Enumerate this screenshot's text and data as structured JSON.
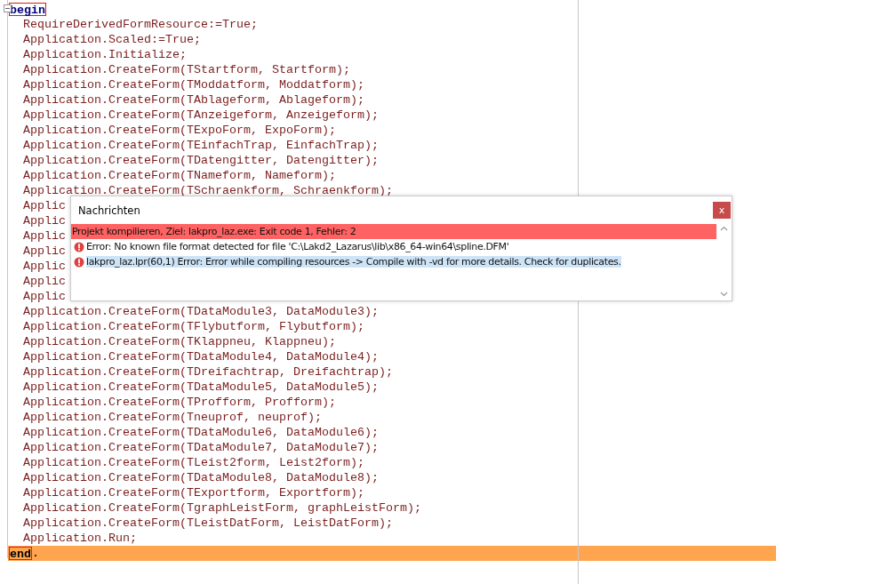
{
  "editor": {
    "lines": [
      {
        "kind": "keyword",
        "keyword": "begin",
        "matched": true,
        "current": false
      },
      {
        "kind": "code",
        "text": "RequireDerivedFormResource:=True;"
      },
      {
        "kind": "code",
        "text": "Application.Scaled:=True;"
      },
      {
        "kind": "code",
        "text": "Application.Initialize;"
      },
      {
        "kind": "code",
        "text": "Application.CreateForm(TStartform, Startform);"
      },
      {
        "kind": "code",
        "text": "Application.CreateForm(TModdatform, Moddatform);"
      },
      {
        "kind": "code",
        "text": "Application.CreateForm(TAblageform, Ablageform);"
      },
      {
        "kind": "code",
        "text": "Application.CreateForm(TAnzeigeform, Anzeigeform);"
      },
      {
        "kind": "code",
        "text": "Application.CreateForm(TExpoForm, ExpoForm);"
      },
      {
        "kind": "code",
        "text": "Application.CreateForm(TEinfachTrap, EinfachTrap);"
      },
      {
        "kind": "code",
        "text": "Application.CreateForm(TDatengitter, Datengitter);"
      },
      {
        "kind": "code",
        "text": "Application.CreateForm(TNameform, Nameform);"
      },
      {
        "kind": "code",
        "text": "Application.CreateForm(TSchraenkform, Schraenkform);"
      },
      {
        "kind": "code",
        "text": "Applic"
      },
      {
        "kind": "code",
        "text": "Applic"
      },
      {
        "kind": "code",
        "text": "Applic"
      },
      {
        "kind": "code",
        "text": "Applic"
      },
      {
        "kind": "code",
        "text": "Applic"
      },
      {
        "kind": "code",
        "text": "Applic"
      },
      {
        "kind": "code",
        "text": "Applic"
      },
      {
        "kind": "code",
        "text": "Application.CreateForm(TDataModule3, DataModule3);"
      },
      {
        "kind": "code",
        "text": "Application.CreateForm(TFlybutform, Flybutform);"
      },
      {
        "kind": "code",
        "text": "Application.CreateForm(TKlappneu, Klappneu);"
      },
      {
        "kind": "code",
        "text": "Application.CreateForm(TDataModule4, DataModule4);"
      },
      {
        "kind": "code",
        "text": "Application.CreateForm(TDreifachtrap, Dreifachtrap);"
      },
      {
        "kind": "code",
        "text": "Application.CreateForm(TDataModule5, DataModule5);"
      },
      {
        "kind": "code",
        "text": "Application.CreateForm(TProfform, Profform);"
      },
      {
        "kind": "code",
        "text": "Application.CreateForm(Tneuprof, neuprof);"
      },
      {
        "kind": "code",
        "text": "Application.CreateForm(TDataModule6, DataModule6);"
      },
      {
        "kind": "code",
        "text": "Application.CreateForm(TDataModule7, DataModule7);"
      },
      {
        "kind": "code",
        "text": "Application.CreateForm(TLeist2form, Leist2form);"
      },
      {
        "kind": "code",
        "text": "Application.CreateForm(TDataModule8, DataModule8);"
      },
      {
        "kind": "code",
        "text": "Application.CreateForm(TExportform, Exportform);"
      },
      {
        "kind": "code",
        "text": "Application.CreateForm(TgraphLeistForm, graphLeistForm);"
      },
      {
        "kind": "code",
        "text": "Application.CreateForm(TLeistDatForm, LeistDatForm);"
      },
      {
        "kind": "code",
        "text": "Application.Run;"
      },
      {
        "kind": "keyword",
        "keyword": "end",
        "rest": ".",
        "matched": true,
        "current": true
      }
    ]
  },
  "messages_window": {
    "title": "Nachrichten",
    "close": "x",
    "messages": [
      {
        "kind": "summary",
        "text": "Projekt kompilieren, Ziel: lakpro_laz.exe: Exit code 1, Fehler: 2",
        "selected": false
      },
      {
        "kind": "error",
        "text": "Error: No known file format detected for file 'C:\\Lakd2_Lazarus\\lib\\x86_64-win64\\spline.DFM'",
        "selected": false
      },
      {
        "kind": "error",
        "text": "lakpro_laz.lpr(60,1) Error: Error while compiling resources -> Compile with -vd for more details. Check for duplicates.",
        "selected": true
      }
    ]
  }
}
